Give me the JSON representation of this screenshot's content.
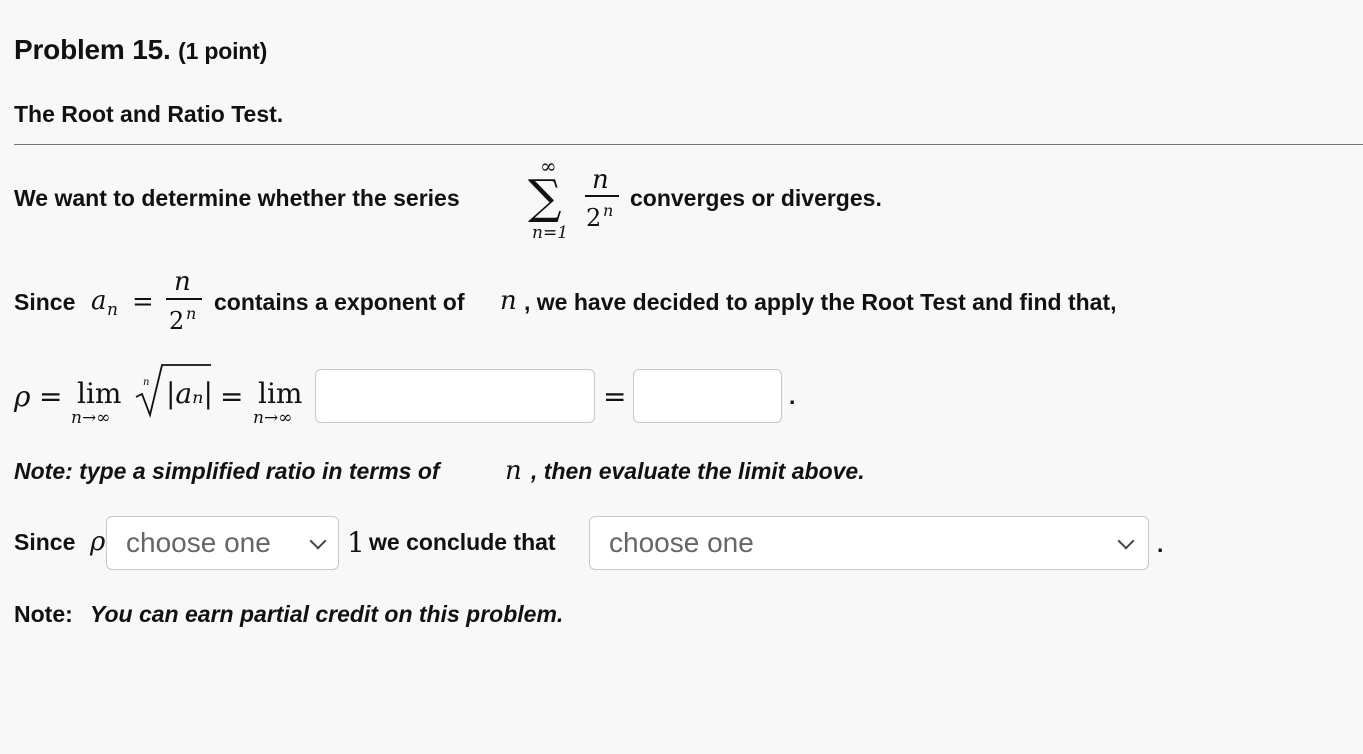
{
  "problem": {
    "title": "Problem 15.",
    "points": "(1 point)"
  },
  "section": {
    "title": "The Root and Ratio Test."
  },
  "series_statement": {
    "prefix": "We want to determine whether the series",
    "summation_upper": "∞",
    "summation_lower": "n=1",
    "numerator": "n",
    "denominator": "2",
    "denominator_exponent": "n",
    "suffix": "converges or diverges."
  },
  "root_statement": {
    "prefix": "Since",
    "term": "a",
    "term_subscript": "n",
    "equals": "=",
    "numerator": "n",
    "denominator": "2",
    "denominator_exponent": "n",
    "middle": "contains a exponent of",
    "variable": "n",
    "suffix": ", we have decided to apply the Root Test and find that,"
  },
  "rho_line": {
    "rho": "ρ",
    "equals": "=",
    "lim": "lim",
    "limit_subscript": "n→∞",
    "root_index": "n",
    "absolute_value": "|aₙ|",
    "equals_2": "=",
    "lim_2": "lim",
    "limit_subscript_2": "n→∞",
    "ratio_input_value": "",
    "equals_3": "=",
    "limit_input_value": "",
    "period": "."
  },
  "note_1": {
    "prefix": "Note: type a simplified ratio in terms of",
    "variable": "n",
    "suffix": ", then evaluate the limit above."
  },
  "conclusion": {
    "prefix": "Since",
    "rho": "ρ",
    "comparison_select": "choose one",
    "value": "1",
    "middle": "we conclude that",
    "result_select": "choose one",
    "period": "."
  },
  "note_2": {
    "label": "Note:",
    "text": "You can earn partial credit on this problem."
  },
  "colors": {
    "background": "#f8f8f8",
    "text": "#111111",
    "border": "#c8c8c8",
    "select_text": "#666666"
  },
  "icons": {
    "select_chevron": "chevron-down-icon"
  }
}
